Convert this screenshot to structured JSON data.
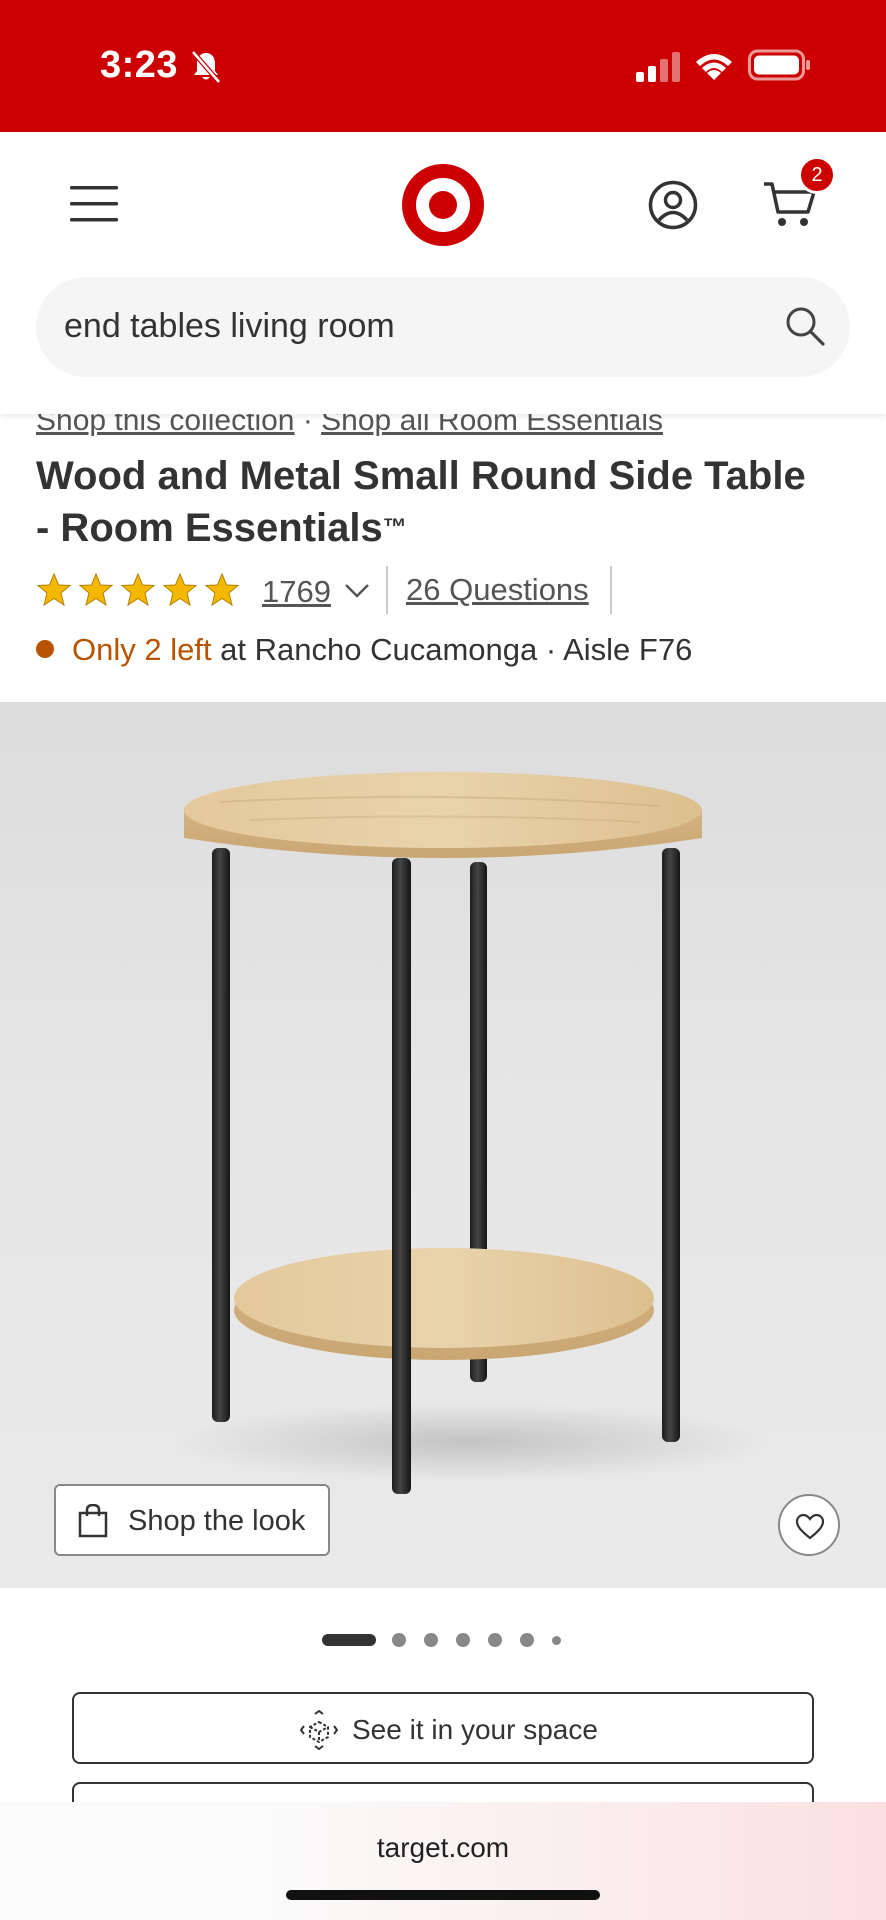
{
  "status_bar": {
    "time": "3:23"
  },
  "header": {
    "cart_count": "2",
    "search": {
      "value": "end tables living room"
    }
  },
  "product": {
    "links": {
      "collection": "Shop this collection",
      "separator": " · ",
      "brand": "Shop all Room Essentials"
    },
    "title": "Wood and Metal Small Round Side Table - Room Essentials",
    "title_mark": "™",
    "rating": {
      "stars": 5,
      "count": "1769"
    },
    "questions": "26 Questions",
    "stock": {
      "alert": "Only 2 left",
      "location": " at Rancho Cucamonga · Aisle F76"
    },
    "shop_the_look": "Shop the look",
    "carousel": {
      "total": 7,
      "active": 1
    },
    "see_in_space": "See it in your space"
  },
  "browser": {
    "url": "target.com"
  },
  "colors": {
    "brand_red": "#cc0000",
    "stock_alert": "#b85300",
    "star": "#f5b800"
  }
}
